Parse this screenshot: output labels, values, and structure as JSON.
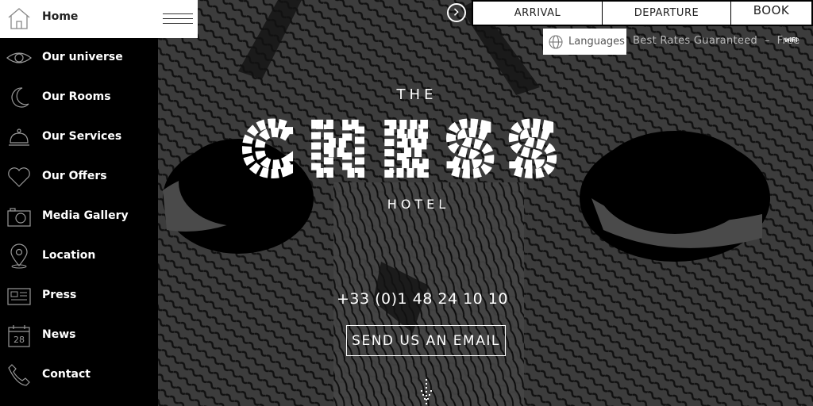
{
  "sidebar": {
    "home_label": "Home",
    "items": [
      {
        "label": "Our universe",
        "icon": "eye-icon"
      },
      {
        "label": "Our Rooms",
        "icon": "moon-icon"
      },
      {
        "label": "Our Services",
        "icon": "service-bell-icon"
      },
      {
        "label": "Our Offers",
        "icon": "heart-icon"
      },
      {
        "label": "Media Gallery",
        "icon": "camera-icon"
      },
      {
        "label": "Location",
        "icon": "map-pin-icon"
      },
      {
        "label": "Press",
        "icon": "newspaper-icon"
      },
      {
        "label": "News",
        "icon": "calendar-icon"
      },
      {
        "label": "Contact",
        "icon": "phone-icon"
      }
    ],
    "calendar_day": "28"
  },
  "booking": {
    "arrival": "ARRIVAL",
    "departure": "DEPARTURE",
    "book": "BOOK"
  },
  "languages_label": "Languages",
  "rates_text": "Best Rates Guaranteed  –  Free",
  "wifi_badge": "wiFi",
  "logo": {
    "the": "THE",
    "chess": "CHESS",
    "hotel": "HOTEL"
  },
  "phone": "+33 (0)1 48 24 10 10",
  "email_button": "SEND US AN EMAIL",
  "colors": {
    "background": "#000000",
    "owl_gray": "#4a4a4a",
    "text": "#ffffff",
    "panel": "#ffffff"
  }
}
